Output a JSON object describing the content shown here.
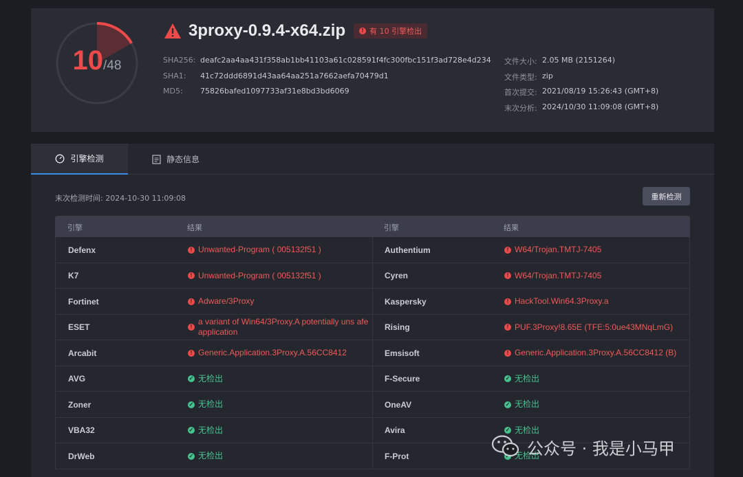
{
  "summary": {
    "detected": "10",
    "total": "/48",
    "file_name": "3proxy-0.9.4-x64.zip",
    "badge": "有 10 引擎检出",
    "hashes": [
      {
        "k": "SHA256:",
        "v": "deafc2aa4aa431f358ab1bb41103a61c028591f4fc300fbc151f3ad728e4d234"
      },
      {
        "k": "SHA1:",
        "v": "41c72ddd6891d43aa64aa251a7662aefa70479d1"
      },
      {
        "k": "MD5:",
        "v": "75826bafed1097733af31e8bd3bd6069"
      }
    ],
    "meta": [
      {
        "k": "文件大小:",
        "v": "2.05 MB (2151264)"
      },
      {
        "k": "文件类型:",
        "v": "zip"
      },
      {
        "k": "首次提交:",
        "v": "2021/08/19 15:26:43 (GMT+8)"
      },
      {
        "k": "末次分析:",
        "v": "2024/10/30 11:09:08 (GMT+8)"
      }
    ]
  },
  "tabs": {
    "engine": "引擎检测",
    "static": "静态信息"
  },
  "scan": {
    "last_scan": "末次检测时间: 2024-10-30 11:09:08",
    "rescan_label": "重新检测"
  },
  "table": {
    "headers": [
      "引擎",
      "结果",
      "引擎",
      "结果"
    ],
    "rows": [
      {
        "e1": "Defenx",
        "r1": "Unwanted-Program ( 005132f51 )",
        "e2": "Authentium",
        "r2": "W64/Trojan.TMTJ-7405"
      },
      {
        "e1": "K7",
        "r1": "Unwanted-Program ( 005132f51 )",
        "e2": "Cyren",
        "r2": "W64/Trojan.TMTJ-7405"
      },
      {
        "e1": "Fortinet",
        "r1": "Adware/3Proxy",
        "e2": "Kaspersky",
        "r2": "HackTool.Win64.3Proxy.a"
      },
      {
        "e1": "ESET",
        "r1": "a variant of Win64/3Proxy.A potentially uns afe application",
        "e2": "Rising",
        "r2": "PUF.3Proxy!8.65E (TFE:5:0ue43MNqLmG)"
      },
      {
        "e1": "Arcabit",
        "r1": "Generic.Application.3Proxy.A.56CC8412",
        "e2": "Emsisoft",
        "r2": "Generic.Application.3Proxy.A.56CC8412 (B)"
      },
      {
        "e1": "AVG",
        "r1": "无检出",
        "e2": "F-Secure",
        "r2": "无检出"
      },
      {
        "e1": "Zoner",
        "r1": "无检出",
        "e2": "OneAV",
        "r2": "无检出"
      },
      {
        "e1": "VBA32",
        "r1": "无检出",
        "e2": "Avira",
        "r2": "无检出"
      },
      {
        "e1": "DrWeb",
        "r1": "无检出",
        "e2": "F-Prot",
        "r2": "无检出"
      }
    ]
  },
  "watermark": "公众号 · 我是小马甲",
  "colors": {
    "danger": "#ef4a4a",
    "clean": "#46c28e",
    "accent": "#3a8ee6"
  }
}
